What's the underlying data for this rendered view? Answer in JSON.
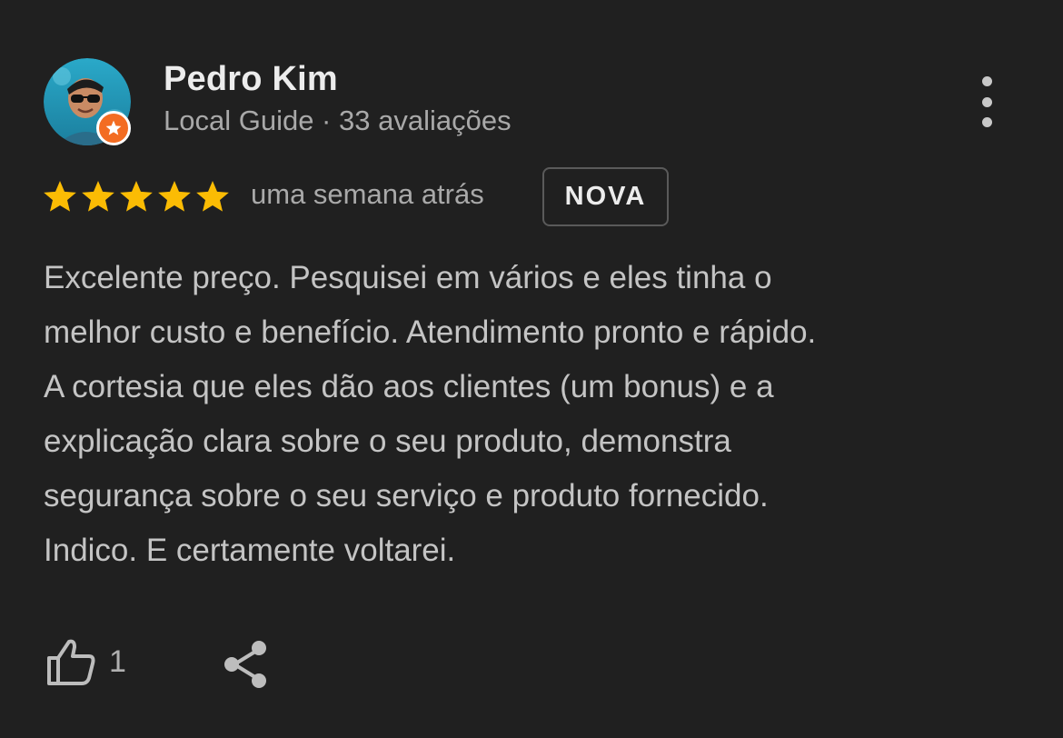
{
  "reviewer": {
    "name": "Pedro Kim",
    "subtitle": "Local Guide · 33 avaliações",
    "badge_color": "#f36c22"
  },
  "rating": {
    "stars": 5,
    "max_stars": 5,
    "star_color": "#fbbc04"
  },
  "time_ago": "uma semana atrás",
  "new_badge": "NOVA",
  "review_lines": [
    "Excelente preço. Pesquisei em vários e eles tinha o",
    "melhor custo e benefício. Atendimento pronto e rápido.",
    "A cortesia que eles dão aos clientes (um bonus) e a",
    "explicação clara sobre o seu produto, demonstra",
    "segurança sobre o seu serviço e produto fornecido.",
    "Indico. E certamente voltarei."
  ],
  "actions": {
    "like_count": "1",
    "like_icon": "thumbs-up-icon",
    "share_icon": "share-icon",
    "menu_icon": "more-vert-icon"
  }
}
